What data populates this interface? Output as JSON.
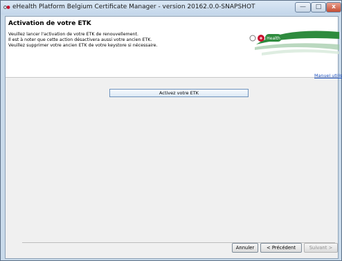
{
  "window": {
    "title": "eHealth Platform Belgium Certificate Manager - version 20162.0.0-SNAPSHOT",
    "controls": {
      "minimize": "—",
      "maximize": "□",
      "close": "x"
    }
  },
  "header": {
    "title": "Activation de votre ETK",
    "lines": [
      "Veuillez lancer l'activation de votre ETK de renouvellement.",
      "Il est à noter que cette action désactivera aussi votre ancien ETK.",
      "Veuillez supprimer votre ancien ETK de votre keystore si nécessaire."
    ],
    "logo_text": "Health"
  },
  "links": {
    "manual": "Manuel utilisate"
  },
  "main": {
    "activate_label": "Activez votre ETK"
  },
  "footer": {
    "cancel_label": "Annuler",
    "previous_label": "< Précédent",
    "next_label": "Suivant >"
  },
  "colors": {
    "brand_green": "#2e8b3e",
    "brand_red": "#c8102e",
    "link_blue": "#1b4fbf"
  }
}
